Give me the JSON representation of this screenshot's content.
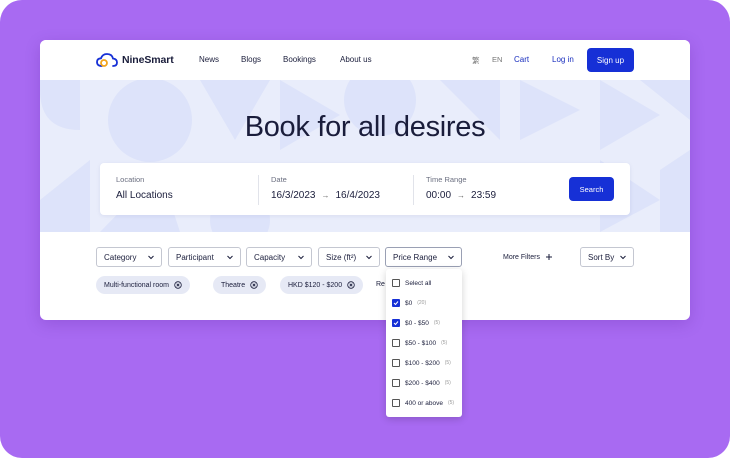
{
  "brand": {
    "name": "NineSmart",
    "accent": "#1630d6",
    "frame_color": "#a86af2"
  },
  "nav": {
    "links": [
      "News",
      "Blogs",
      "Bookings",
      "About us"
    ],
    "lang_tc": "繁",
    "lang_en": "EN",
    "cart": "Cart",
    "login": "Log in",
    "signup": "Sign up"
  },
  "hero": {
    "title": "Book for all desires",
    "location": {
      "label": "Location",
      "value": "All Locations"
    },
    "date": {
      "label": "Date",
      "from": "16/3/2023",
      "to": "16/4/2023"
    },
    "time": {
      "label": "Time Range",
      "from": "00:00",
      "to": "23:59"
    },
    "search_button": "Search"
  },
  "filters": {
    "items": [
      "Category",
      "Participant",
      "Capacity",
      "Size (ft²)",
      "Price Range"
    ],
    "more": "More Filters",
    "sort": "Sort By",
    "tags": [
      "Multi-functional room",
      "Theatre",
      "HKD $120 - $200"
    ],
    "reset_partial": "Re"
  },
  "price_dropdown": {
    "options": [
      {
        "label": "Select all",
        "count": "",
        "checked": false
      },
      {
        "label": "$0",
        "count": "(20)",
        "checked": true
      },
      {
        "label": "$0 - $50",
        "count": "(5)",
        "checked": true
      },
      {
        "label": "$50 - $100",
        "count": "(5)",
        "checked": false
      },
      {
        "label": "$100 - $200",
        "count": "(5)",
        "checked": false
      },
      {
        "label": "$200 - $400",
        "count": "(5)",
        "checked": false
      },
      {
        "label": "400 or above",
        "count": "(5)",
        "checked": false
      }
    ]
  }
}
